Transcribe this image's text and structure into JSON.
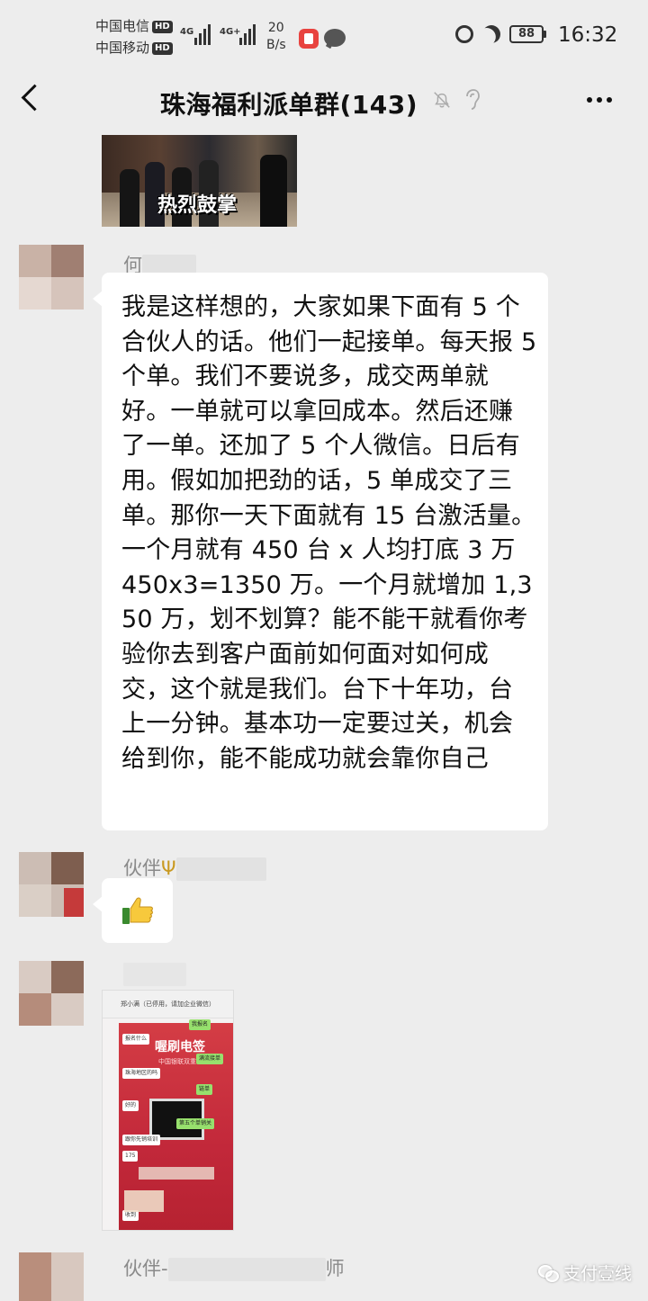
{
  "status_bar": {
    "carrier1": "中国电信",
    "carrier2": "中国移动",
    "hd_label": "HD",
    "network1": "4G",
    "network2": "4G+",
    "net_speed_value": "20",
    "net_speed_unit": "B/s",
    "battery": "88",
    "time": "16:32"
  },
  "nav": {
    "title": "珠海福利派单群(143)"
  },
  "sticker": {
    "caption": "热烈鼓掌"
  },
  "messages": [
    {
      "sender": "何",
      "text": "我是这样想的，大家如果下面有 5 个合伙人的话。他们一起接单。每天报 5 个单。我们不要说多，成交两单就好。一单就可以拿回成本。然后还赚了一单。还加了 5 个人微信。日后有用。假如加把劲的话，5 单成交了三单。那你一天下面就有 15 台激活量。一个月就有 450 台 x 人均打底 3 万 450x3=1350 万。一个月就增加 1,350 万，划不划算？能不能干就看你考验你去到客户面前如何面对如何成交，这个就是我们。台下十年功，台上一分钟。基本功一定要过关，机会给到你，能不能成功就会靠你自己"
    },
    {
      "sender_prefix": "伙伴",
      "emoji": "thumbs-up"
    },
    {
      "screenshot": {
        "header": "郑小满（已停用，请加企业微信）",
        "brand": "喔刷电签",
        "sub": "中国银联双重",
        "chips": [
          "报名什么",
          "珠海地区的吗",
          "好的",
          "跟你先销培训",
          "175",
          "收到",
          "我报名",
          "满流接单",
          "链单",
          "第五个单销关"
        ]
      }
    },
    {
      "sender_prefix": "伙伴-",
      "sender_suffix": "师"
    }
  ],
  "watermark": {
    "text": "支付壹线"
  },
  "colors": {
    "background": "#ededed",
    "bubble": "#ffffff",
    "sender_gray": "#8a8a8a"
  }
}
